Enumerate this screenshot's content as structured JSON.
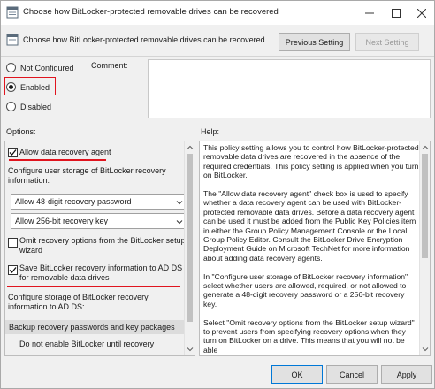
{
  "window": {
    "title": "Choose how BitLocker-protected removable drives can be recovered",
    "minimize_icon": "minimize-icon",
    "maximize_icon": "maximize-icon",
    "close_icon": "close-icon"
  },
  "header": {
    "title": "Choose how BitLocker-protected removable drives can be recovered",
    "previous_label": "Previous Setting",
    "next_label": "Next Setting"
  },
  "state": {
    "not_configured_label": "Not Configured",
    "enabled_label": "Enabled",
    "disabled_label": "Disabled",
    "selected": "Enabled"
  },
  "comment": {
    "label": "Comment:",
    "value": ""
  },
  "options": {
    "label": "Options:",
    "allow_recovery_agent": {
      "label": "Allow data recovery agent",
      "checked": true
    },
    "configure_storage_label": "Configure user storage of BitLocker recovery information:",
    "password_select": "Allow 48-digit recovery password",
    "key_select": "Allow 256-bit recovery key",
    "omit_options": {
      "label": "Omit recovery options from the BitLocker setup wizard",
      "checked": false
    },
    "save_to_adds": {
      "label": "Save BitLocker recovery information to AD DS for removable data drives",
      "checked": true
    },
    "configure_adds_label": "Configure storage of BitLocker recovery information to AD DS:",
    "backup_select": "Backup recovery passwords and key packages",
    "do_not_enable_label": "Do not enable BitLocker until recovery"
  },
  "help": {
    "label": "Help:",
    "paragraphs": [
      "This policy setting allows you to control how BitLocker-protected removable data drives are recovered in the absence of the required credentials. This policy setting is applied when you turn on BitLocker.",
      "The \"Allow data recovery agent\" check box is used to specify whether a data recovery agent can be used with BitLocker-protected removable data drives. Before a data recovery agent can be used it must be added from the Public Key Policies item in either the Group Policy Management Console or the Local Group Policy Editor. Consult the BitLocker Drive Encryption Deployment Guide on Microsoft TechNet for more information about adding data recovery agents.",
      "In \"Configure user storage of BitLocker recovery information\" select whether users are allowed, required, or not allowed to generate a 48-digit recovery password or a 256-bit recovery key.",
      "Select \"Omit recovery options from the BitLocker setup wizard\" to prevent users from specifying recovery options when they turn on BitLocker on a drive. This means that you will not be able"
    ]
  },
  "footer": {
    "ok_label": "OK",
    "cancel_label": "Cancel",
    "apply_label": "Apply"
  },
  "colors": {
    "highlight": "#e0141e",
    "accent": "#0078d7"
  }
}
